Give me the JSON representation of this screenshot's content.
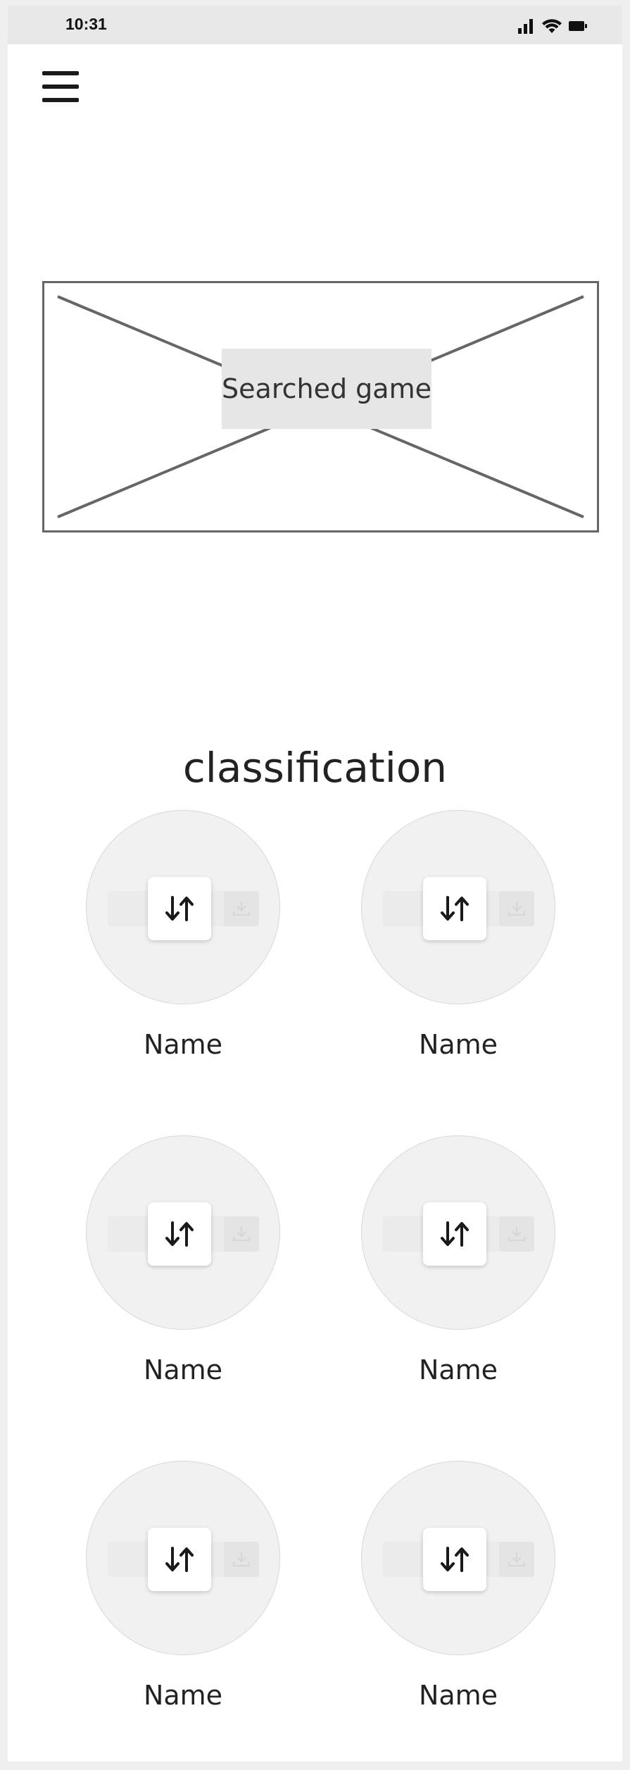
{
  "status_bar": {
    "time": "10:31",
    "icons": [
      "signal-icon",
      "wifi-icon",
      "battery-icon"
    ]
  },
  "header": {
    "menu_icon": "hamburger-menu-icon"
  },
  "banner": {
    "label": "Searched game",
    "image_icon": "image-placeholder-icon"
  },
  "classification": {
    "title": "classification",
    "items": [
      {
        "name": "Name",
        "icon": "swap-vertical-icon"
      },
      {
        "name": "Name",
        "icon": "swap-vertical-icon"
      },
      {
        "name": "Name",
        "icon": "swap-vertical-icon"
      },
      {
        "name": "Name",
        "icon": "swap-vertical-icon"
      },
      {
        "name": "Name",
        "icon": "swap-vertical-icon"
      },
      {
        "name": "Name",
        "icon": "swap-vertical-icon"
      }
    ]
  },
  "colors": {
    "frame": "#efefef",
    "status_bar": "#e8e8e8",
    "screen": "#ffffff",
    "placeholder_stroke": "#666666",
    "label_bg": "#e6e6e6",
    "circle_bg": "#f1f1f1"
  }
}
